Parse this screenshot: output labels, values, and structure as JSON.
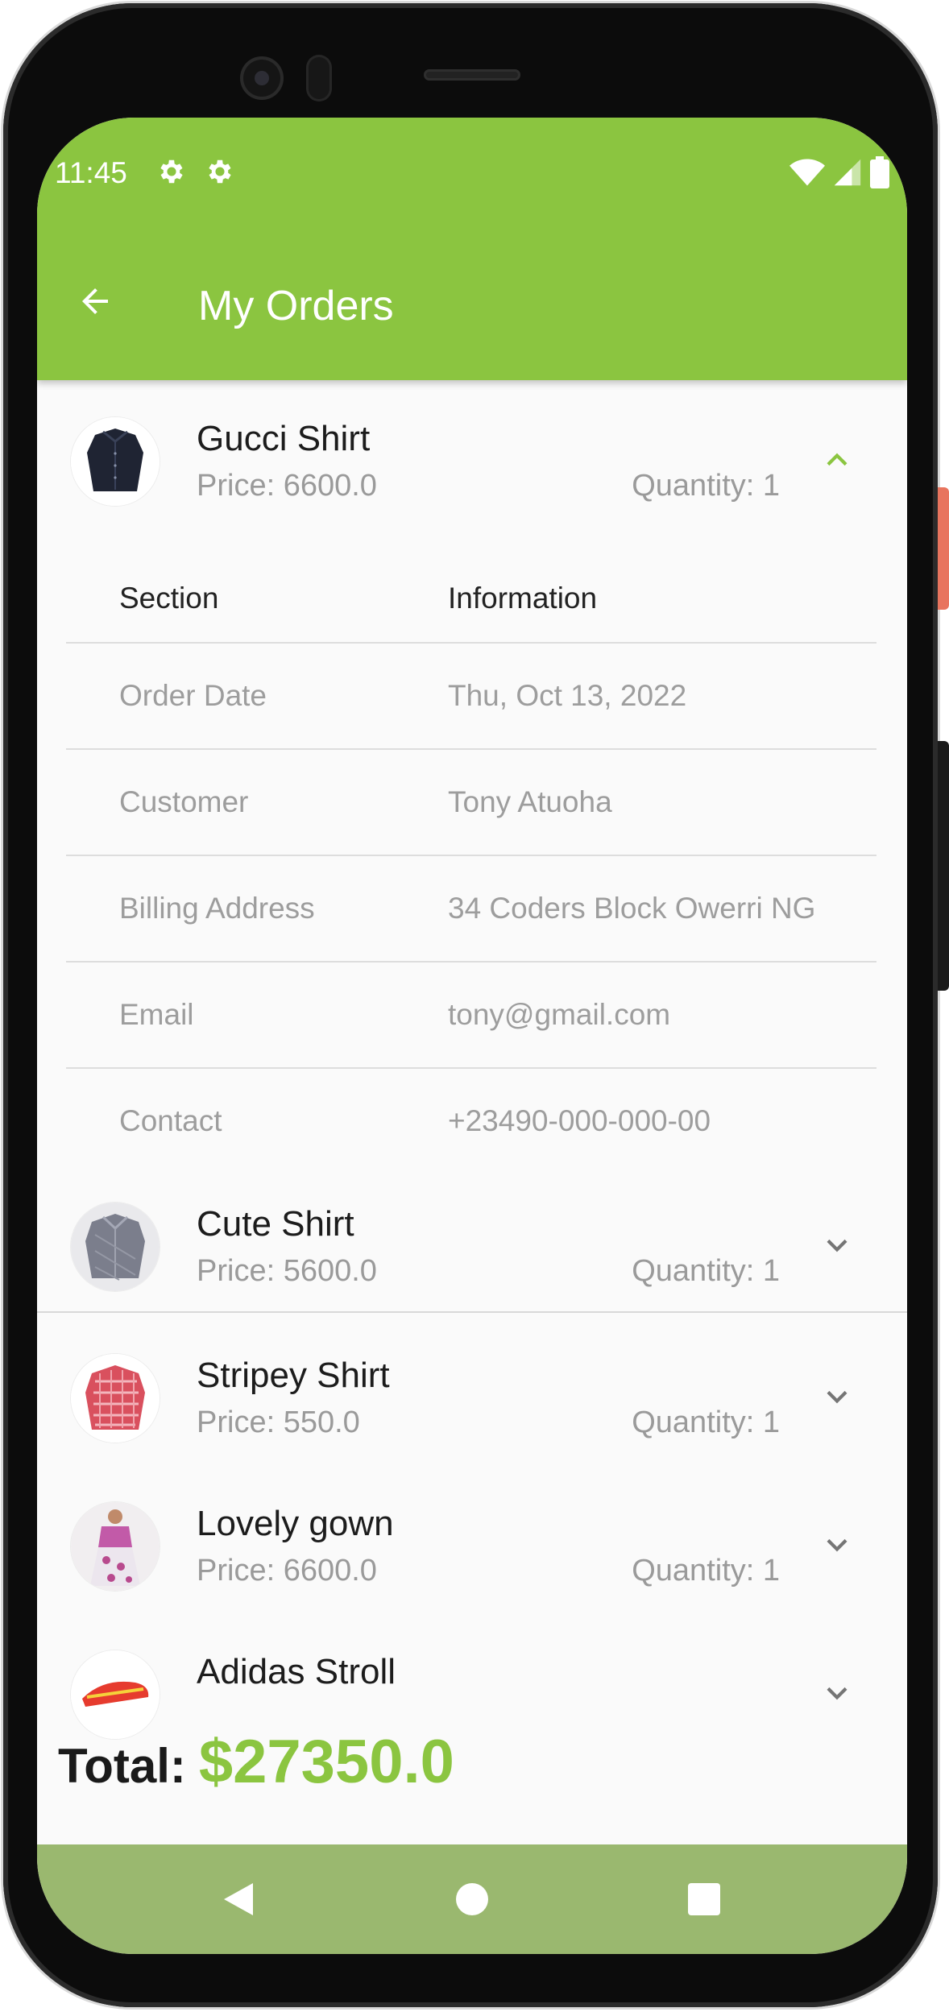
{
  "status_bar": {
    "time": "11:45"
  },
  "app_bar": {
    "title": "My Orders"
  },
  "orders": [
    {
      "name": "Gucci Shirt",
      "price": "Price: 6600.0",
      "quantity": "Quantity: 1",
      "expanded": true
    },
    {
      "name": "Cute Shirt",
      "price": "Price: 5600.0",
      "quantity": "Quantity: 1",
      "expanded": false
    },
    {
      "name": "Stripey Shirt",
      "price": "Price: 550.0",
      "quantity": "Quantity: 1",
      "expanded": false
    },
    {
      "name": "Lovely gown",
      "price": "Price: 6600.0",
      "quantity": "Quantity: 1",
      "expanded": false
    },
    {
      "name": "Adidas Stroll",
      "price": "",
      "quantity": "",
      "expanded": false
    }
  ],
  "details_table": {
    "header": {
      "section": "Section",
      "information": "Information"
    },
    "rows": [
      {
        "section": "Order Date",
        "information": "Thu, Oct 13, 2022"
      },
      {
        "section": "Customer",
        "information": "Tony Atuoha"
      },
      {
        "section": "Billing Address",
        "information": "34 Coders Block Owerri NG"
      },
      {
        "section": "Email",
        "information": "tony@gmail.com"
      },
      {
        "section": "Contact",
        "information": "+23490-000-000-00"
      }
    ]
  },
  "total": {
    "label": "Total:",
    "value": "$27350.0"
  },
  "colors": {
    "primary": "#8bc540",
    "nav_bar": "#9ab86f",
    "background": "#fafafa",
    "secondary_text": "#9d9d9d"
  },
  "icons": [
    "settings-icon",
    "wifi-icon",
    "signal-icon",
    "battery-icon",
    "back-arrow-icon",
    "chevron-up-icon",
    "chevron-down-icon",
    "nav-back-icon",
    "nav-home-icon",
    "nav-recents-icon"
  ]
}
